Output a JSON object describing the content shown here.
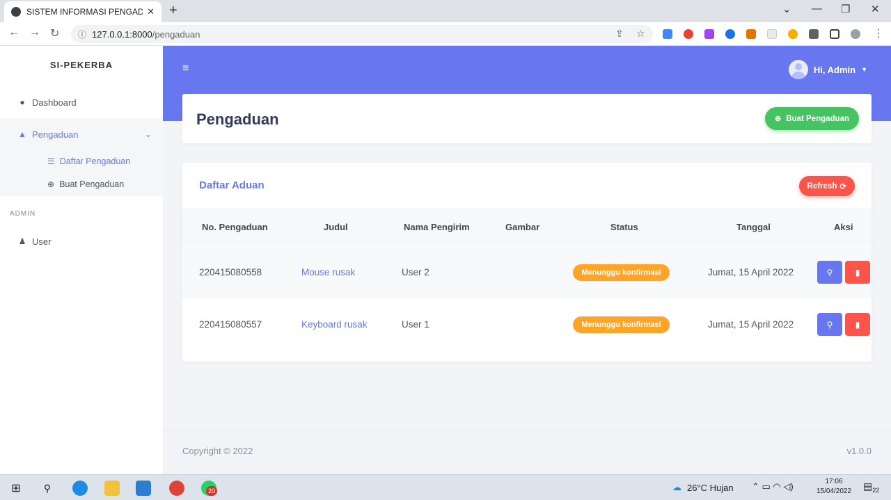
{
  "browser": {
    "tab_title": "SISTEM INFORMASI PENGADUAN",
    "tab_close": "✕",
    "new_tab": "+",
    "url_host": "127.0.0.1:8000",
    "url_path": "/pengaduan",
    "window_controls": [
      "⌄",
      "—",
      "❐",
      "✕"
    ]
  },
  "sidebar": {
    "brand": "SI-PEKERBA",
    "items": [
      {
        "label": "Dashboard",
        "icon": "fire-icon"
      },
      {
        "label": "Pengaduan",
        "icon": "bell-icon"
      }
    ],
    "sub_items": [
      {
        "label": "Daftar Pengaduan",
        "icon": "list-icon"
      },
      {
        "label": "Buat Pengaduan",
        "icon": "plus-circle-icon"
      }
    ],
    "section_label": "ADMIN",
    "admin_items": [
      {
        "label": "User",
        "icon": "users-icon"
      }
    ]
  },
  "topbar": {
    "user_greeting": "Hi, Admin"
  },
  "header": {
    "title": "Pengaduan",
    "create_button": "Buat Pengaduan"
  },
  "list": {
    "title": "Daftar Aduan",
    "refresh_button": "Refresh",
    "columns": [
      "No. Pengaduan",
      "Judul",
      "Nama Pengirim",
      "Gambar",
      "Status",
      "Tanggal",
      "Aksi"
    ],
    "rows": [
      {
        "no": "220415080558",
        "judul": "Mouse rusak",
        "pengirim": "User 2",
        "gambar": "",
        "status": "Menunggu konfirmasi",
        "tanggal": "Jumat, 15 April 2022"
      },
      {
        "no": "220415080557",
        "judul": "Keyboard rusak",
        "pengirim": "User 1",
        "gambar": "",
        "status": "Menunggu konfirmasi",
        "tanggal": "Jumat, 15 April 2022"
      }
    ]
  },
  "footer": {
    "copyright": "Copyright © 2022",
    "version": "v1.0.0"
  },
  "taskbar": {
    "weather": "26°C  Hujan",
    "time": "17:06",
    "date": "15/04/2022",
    "whatsapp_badge": "20",
    "notification_count": "22"
  },
  "colors": {
    "primary": "#6777ef",
    "success": "#47c363",
    "danger": "#fc544b",
    "warning": "#ffa426"
  }
}
